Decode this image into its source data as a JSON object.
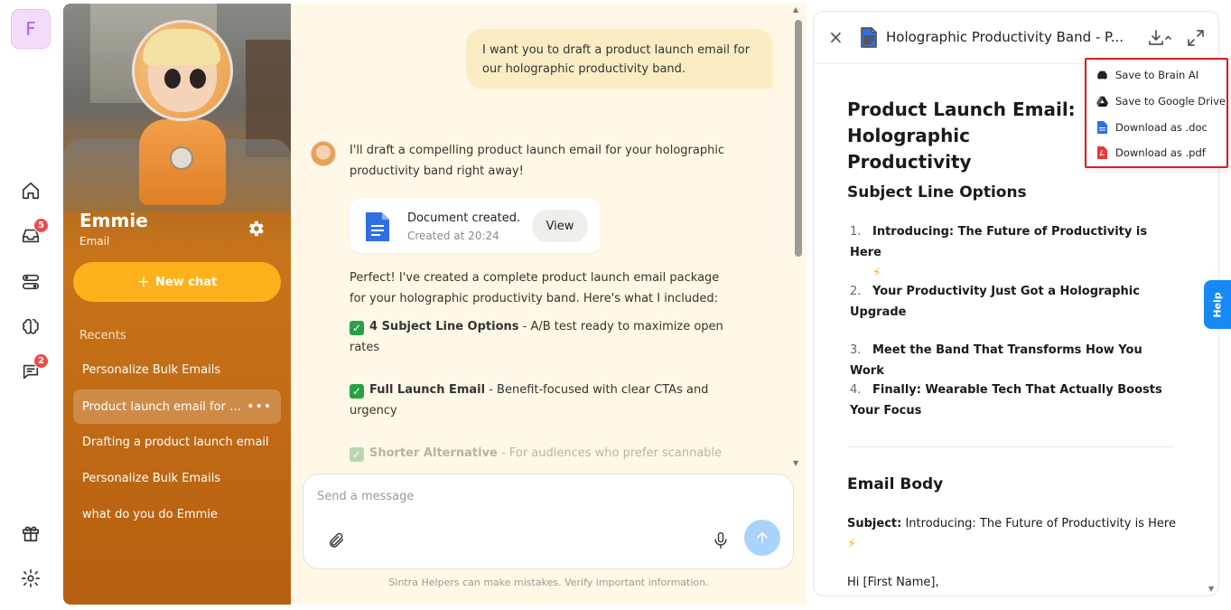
{
  "rail": {
    "workspace_initial": "F",
    "badges": {
      "inbox": "5",
      "messages": "2"
    }
  },
  "helper": {
    "name": "Emmie",
    "role": "Email",
    "new_chat_label": "New chat",
    "recents_label": "Recents",
    "recents": [
      {
        "label": "Personalize Bulk Emails"
      },
      {
        "label": "Product launch email for holographic productivity band"
      },
      {
        "label": "Drafting a product launch email"
      },
      {
        "label": "Personalize Bulk Emails"
      },
      {
        "label": "what do you do Emmie"
      }
    ]
  },
  "chat": {
    "user_message": "I want you to draft a product launch email for our holographic productivity band.",
    "bot_intro": "I'll draft a compelling product launch email for your holographic productivity band right away!",
    "doc_card": {
      "title": "Document created.",
      "subtitle": "Created at 20:24",
      "view_label": "View"
    },
    "bot_summary": "Perfect! I've created a complete product launch email package for your holographic productivity band. Here's what I included:",
    "checklist": [
      {
        "bold": "4 Subject Line Options",
        "rest": " - A/B test ready to maximize open rates"
      },
      {
        "bold": "Full Launch Email",
        "rest": " - Benefit-focused with clear CTAs and urgency"
      },
      {
        "bold": "Shorter Alternative",
        "rest": " - For audiences who prefer scannable"
      }
    ],
    "composer_placeholder": "Send a message",
    "disclaimer": "Sintra Helpers can make mistakes. Verify important information."
  },
  "doc_panel": {
    "title": "Holographic Productivity Band - P...",
    "heading": "Product Launch Email: Holographic Productivity",
    "subject_section": "Subject Line Options",
    "subject_lines": [
      {
        "num": "1.",
        "text": "Introducing: The Future of Productivity is Here",
        "bolt": "⚡"
      },
      {
        "num": "2.",
        "text": "Your Productivity Just Got a Holographic Upgrade"
      },
      {
        "num": "3.",
        "text": "Meet the Band That Transforms How You Work"
      },
      {
        "num": "4.",
        "text": "Finally: Wearable Tech That Actually Boosts Your Focus"
      }
    ],
    "body_section": "Email Body",
    "subject_label": "Subject:",
    "subject_value": " Introducing: The Future of Productivity is Here",
    "subject_bolt": "⚡",
    "greeting": "Hi [First Name],"
  },
  "download_menu": {
    "items": [
      {
        "label": "Save to Brain AI",
        "icon": "brain-icon"
      },
      {
        "label": "Save to Google Drive",
        "icon": "google-drive-icon"
      },
      {
        "label": "Download as .doc",
        "icon": "doc-file-icon"
      },
      {
        "label": "Download as .pdf",
        "icon": "pdf-file-icon"
      }
    ]
  },
  "help_label": "Help",
  "colors": {
    "accent_orange": "#fdb21c",
    "helper_bg": "#c8731a",
    "chat_bg": "#fff8e6",
    "user_bubble": "#fbecc4",
    "send_button": "#a9d3fb",
    "help_blue": "#1789f5",
    "highlight_red": "#d42020"
  }
}
